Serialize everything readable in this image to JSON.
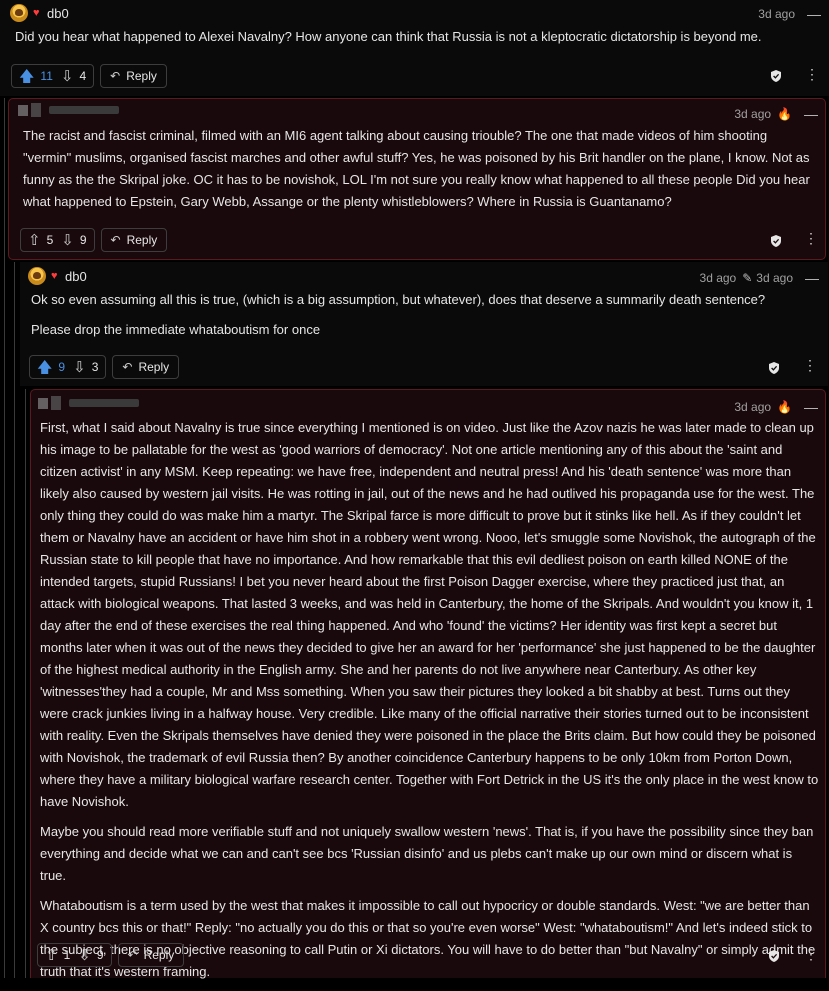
{
  "comments": [
    {
      "username": "db0",
      "time": "3d ago",
      "paragraphs": [
        "Did you hear what happened to Alexei Navalny? How anyone can think that Russia is not a kleptocratic dictatorship is beyond me."
      ],
      "upvotes": "11",
      "downvotes": "4",
      "reply_label": "Reply"
    },
    {
      "username": "",
      "time": "3d ago",
      "paragraphs": [
        "The racist and fascist criminal, filmed with an MI6 agent talking about causing triouble? The one that made videos of him shooting \"vermin\" muslims, organised fascist marches and other awful stuff? Yes, he was poisoned by his Brit handler on the plane, I know. Not as funny as the the Skripal joke. OC it has to be novishok, LOL I'm not sure you really know what happened to all these people Did you hear what happened to Epstein, Gary Webb, Assange or the plenty whistleblowers? Where in Russia is Guantanamo?"
      ],
      "upvotes": "5",
      "downvotes": "9",
      "reply_label": "Reply"
    },
    {
      "username": "db0",
      "time": "3d ago",
      "edited_time": "3d ago",
      "paragraphs": [
        "Ok so even assuming all this is true, (which is a big assumption, but whatever), does that deserve a summarily death sentence?",
        "Please drop the immediate whataboutism for once"
      ],
      "upvotes": "9",
      "downvotes": "3",
      "reply_label": "Reply"
    },
    {
      "username": "",
      "time": "3d ago",
      "paragraphs": [
        "First, what I said about Navalny is true since everything I mentioned is on video. Just like the Azov nazis he was later made to clean up his image to be pallatable for the west as 'good warriors of democracy'. Not one article mentioning any of this about the 'saint and citizen activist' in any MSM. Keep repeating: we have free, independent and neutral press! And his 'death sentence' was more than likely also caused by western jail visits. He was rotting in jail, out of the news and he had outlived his propaganda use for the west. The only thing they could do was make him a martyr. The Skripal farce is more difficult to prove but it stinks like hell. As if they couldn't let them or Navalny have an accident or have him shot in a robbery went wrong. Nooo, let's smuggle some Novishok, the autograph of the Russian state to kill people that have no importance. And how remarkable that this evil dedliest poison on earth killed NONE of the intended targets, stupid Russians! I bet you never heard about the first Poison Dagger exercise, where they practiced just that, an attack with biological weapons. That lasted 3 weeks, and was held in Canterbury, the home of the Skripals. And wouldn't you know it, 1 day after the end of these exercises the real thing happened. And who 'found' the victims? Her identity was first kept a secret but months later when it was out of the news they decided to give her an award for her 'performance' she just happened to be the daughter of the highest medical authority in the English army. She and her parents do not live anywhere near Canterbury. As other key 'witnesses'they had a couple, Mr and Mss something. When you saw their pictures they looked a bit shabby at best. Turns out they were crack junkies living in a halfway house. Very credible. Like many of the official narrative their stories turned out to be inconsistent with reality. Even the Skripals themselves have denied they were poisoned in the place the Brits claim. But how could they be poisoned with Novishok, the trademark of evil Russia then? By another coincidence Canterbury happens to be only 10km from Porton Down, where they have a military biological warfare research center. Together with Fort Detrick in the US it's the only place in the west know to have Novishok.",
        "Maybe you should read more verifiable stuff and not uniquely swallow western 'news'. That is, if you have the possibility since they ban everything and decide what we can and can't see bcs 'Russian disinfo' and us plebs can't make up our own mind or discern what is true.",
        "Whataboutism is a term used by the west that makes it impossible to call out hypocricy or double standards. West: \"we are better than X country bcs this or that!\" Reply: \"no actually you do this or that so you're even worse\" West: \"whataboutism!\" And let's indeed stick to the subject, there is no objective reasoning to call Putin or Xi dictators. You will have to do better than \"but Navalny\" or simply admit the truth that it's western framing."
      ],
      "upvotes": "1",
      "downvotes": "9",
      "reply_label": "Reply"
    }
  ],
  "icons": {
    "upvote": "arrow-up-icon",
    "downvote": "arrow-down-icon",
    "reply": "reply-icon",
    "shield": "shield-check-icon",
    "flame": "flame-icon",
    "heart": "heart-icon",
    "edit": "pencil-icon",
    "collapse": "minus-icon"
  },
  "colors": {
    "upvote_active": "#4a90e2",
    "highlight_bg": "#1a090c",
    "highlight_border": "#5a1a20",
    "flame": "#e04a2e",
    "heart": "#ff3b3b"
  }
}
